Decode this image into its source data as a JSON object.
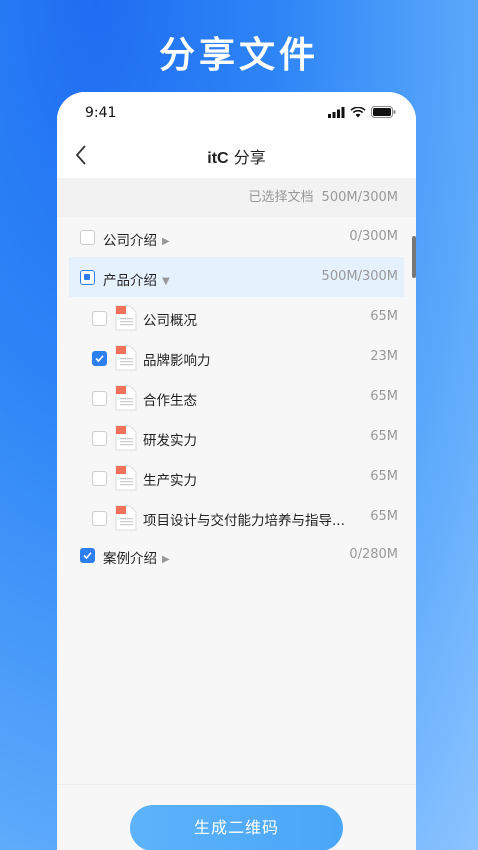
{
  "hero": {
    "title": "分享文件"
  },
  "status_bar": {
    "time": "9:41"
  },
  "nav": {
    "brand": "itC",
    "title": "分享"
  },
  "summary": {
    "label": "已选择文档",
    "value": "500M/300M"
  },
  "folders": [
    {
      "name": "公司介绍",
      "size": "0/300M",
      "state": "unchecked",
      "expanded": false
    },
    {
      "name": "产品介绍",
      "size": "500M/300M",
      "state": "partial",
      "expanded": true
    },
    {
      "name": "案例介绍",
      "size": "0/280M",
      "state": "checked",
      "expanded": false
    }
  ],
  "files": [
    {
      "name": "公司概况",
      "size": "65M",
      "checked": false
    },
    {
      "name": "品牌影响力",
      "size": "23M",
      "checked": true
    },
    {
      "name": "合作生态",
      "size": "65M",
      "checked": false
    },
    {
      "name": "研发实力",
      "size": "65M",
      "checked": false
    },
    {
      "name": "生产实力",
      "size": "65M",
      "checked": false
    },
    {
      "name": "项目设计与交付能力培养与指导...",
      "size": "65M",
      "checked": false
    }
  ],
  "actions": {
    "generate_label": "生成二维码"
  },
  "colors": {
    "accent": "#2d7ff0",
    "button": "#4aa6f8"
  }
}
